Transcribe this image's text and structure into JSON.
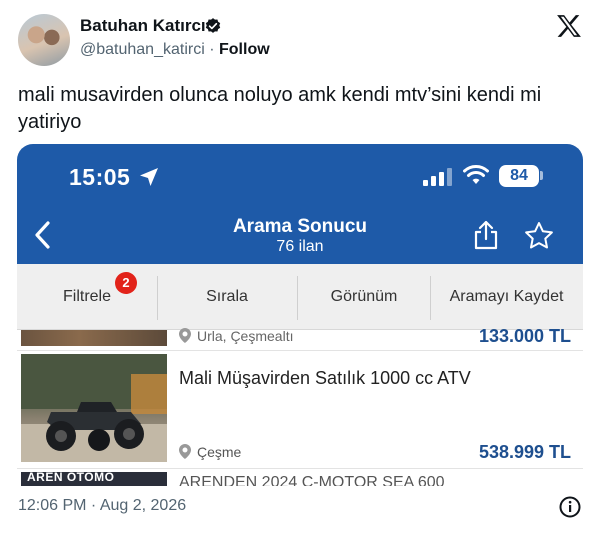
{
  "tweet": {
    "author_name": "Batuhan Katırcı",
    "handle": "@batuhan_katirci",
    "separator": "·",
    "follow_label": "Follow",
    "text": "mali musavirden olunca noluyo amk kendi mtv’sini kendi mi yatiriyo",
    "timestamp": "12:06 PM · Aug 2, 2026",
    "icons": [
      "verified-icon",
      "x-logo-icon",
      "info-icon"
    ]
  },
  "phone": {
    "status_time": "15:05",
    "battery": "84",
    "header_title": "Arama Sonucu",
    "header_subtitle": "76 ilan",
    "toolbar": {
      "filter_label": "Filtrele",
      "filter_badge": "2",
      "sort_label": "Sırala",
      "view_label": "Görünüm",
      "save_label": "Aramayı Kaydet"
    },
    "listings": [
      {
        "location": "Urla, Çeşmealtı",
        "price": "133.000 TL"
      },
      {
        "title": "Mali Müşavirden Satılık 1000 cc ATV",
        "location": "Çeşme",
        "price": "538.999 TL"
      },
      {
        "thumb_text": "AREN OTOMO",
        "title": "ARENDEN 2024 C-MOTOR SEA 600"
      }
    ],
    "colors": {
      "header_bg": "#1e5aa8",
      "price": "#1e4f8f",
      "badge": "#e2231a"
    }
  }
}
